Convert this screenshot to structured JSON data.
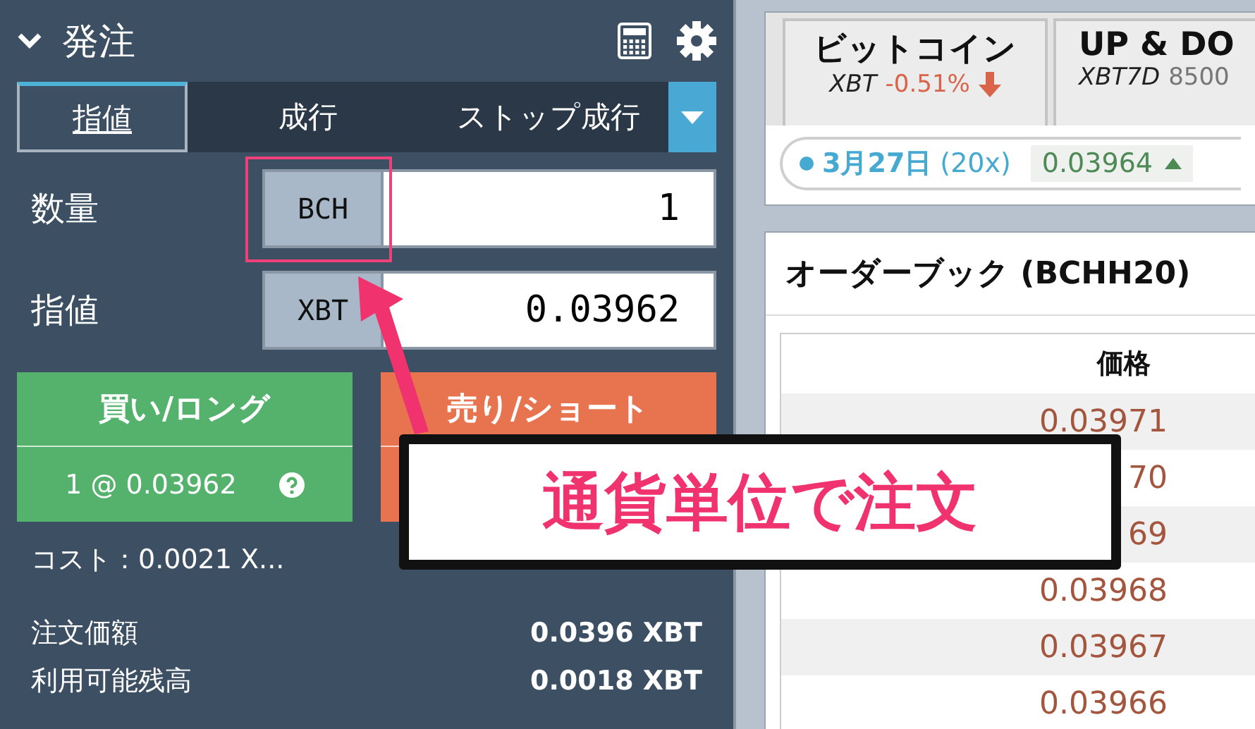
{
  "order_panel": {
    "title": "発注",
    "order_types": [
      {
        "label": "指値",
        "selected": true
      },
      {
        "label": "成行",
        "selected": false
      },
      {
        "label": "ストップ成行",
        "selected": false
      }
    ],
    "fields": [
      {
        "label": "数量",
        "unit": "BCH",
        "value": "1",
        "highlighted": true
      },
      {
        "label": "指値",
        "unit": "XBT",
        "value": "0.03962",
        "highlighted": false
      }
    ],
    "buy_button": {
      "label": "買い/ロング",
      "detail": "1 @ 0.03962"
    },
    "sell_button": {
      "label": "売り/ショート"
    },
    "cost": "コスト：0.0021 X...",
    "summary": [
      {
        "label": "注文価額",
        "value": "0.0396 XBT"
      },
      {
        "label": "利用可能残高",
        "value": "0.0018 XBT"
      }
    ]
  },
  "instruments": {
    "tabs": [
      {
        "name": "ビットコイン",
        "symbol": "XBT",
        "detail": "-0.51%",
        "falling": true
      },
      {
        "name": "UP & DO",
        "symbol": "XBT7D",
        "detail": "8500",
        "falling": false
      }
    ],
    "contract": {
      "date": "3月27日",
      "leverage": "(20x)",
      "price": "0.03964",
      "rising": true
    }
  },
  "order_book": {
    "title": "オーダーブック (BCHH20)",
    "column": "価格",
    "rows": [
      "0.03971",
      "70",
      "69",
      "0.03968",
      "0.03967",
      "0.03966"
    ]
  },
  "annotation": {
    "callout": "通貨単位で注文"
  }
}
